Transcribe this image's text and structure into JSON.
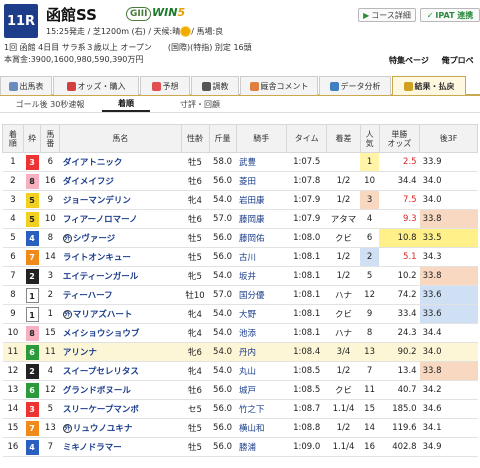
{
  "race": {
    "number": "11R",
    "name": "函館SS",
    "grade": "GIII",
    "win5_a": "WIN",
    "win5_b": "5",
    "line1a": "15:25発走 / 芝1200m (右) / 天候:晴",
    "line1b": "/ 馬場:良",
    "line2": "1回 函館 4日目 サラ系３歳以上 オープン　　(国際)(特指) 別定 16頭",
    "line3": "本賞金:3900,1600,980,590,390万円",
    "course_btn": "コース詳細",
    "ipat_btn": "IPAT 連携",
    "links": [
      "特集ページ",
      "俺プロペ"
    ]
  },
  "tabs": [
    {
      "label": "出馬表",
      "icon": "table-icon",
      "color": "#6a8cc0"
    },
    {
      "label": "オッズ・購入",
      "icon": "ticket-icon",
      "color": "#d04040"
    },
    {
      "label": "予想",
      "icon": "target-icon",
      "color": "#e05050"
    },
    {
      "label": "調教",
      "icon": "stopwatch-icon",
      "color": "#555"
    },
    {
      "label": "厩舎コメント",
      "icon": "comment-icon",
      "color": "#e08040"
    },
    {
      "label": "データ分析",
      "icon": "chart-icon",
      "color": "#4080c0"
    },
    {
      "label": "結果・払戻",
      "icon": "coins-icon",
      "color": "#d0a020"
    }
  ],
  "subtabs": [
    "ゴール後 30秒速報",
    "着順",
    "寸評・回顧"
  ],
  "columns": [
    "着\n順",
    "枠",
    "馬\n番",
    "馬名",
    "性齢",
    "斤量",
    "騎手",
    "タイム",
    "着差",
    "人\n気",
    "単勝\nオッズ",
    "後3F"
  ],
  "rows": [
    [
      "1",
      "3",
      "6",
      "ダイアトニック",
      "牡5",
      "58.0",
      "武豊",
      "1:07.5",
      "",
      "1",
      "2.5",
      "33.9",
      "",
      "",
      "l0",
      "p1",
      "pbad"
    ],
    [
      "2",
      "8",
      "16",
      "ダイメイフジ",
      "牡6",
      "56.0",
      "菱田",
      "1:07.8",
      "1/2",
      "10",
      "34.4",
      "34.0",
      "",
      "",
      "",
      "",
      ""
    ],
    [
      "3",
      "5",
      "9",
      "ジョーマンデリン",
      "牝4",
      "54.0",
      "岩田康",
      "1:07.9",
      "1/2",
      "3",
      "7.5",
      "34.0",
      "",
      "",
      "",
      "p3",
      "pbad"
    ],
    [
      "4",
      "5",
      "10",
      "フィアーノロマーノ",
      "牡6",
      "57.0",
      "藤岡康",
      "1:07.9",
      "アタマ",
      "4",
      "9.3",
      "33.8",
      "",
      "",
      "",
      "",
      "pbad"
    ],
    [
      "5",
      "4",
      "8",
      "シヴァージ",
      "牡5",
      "56.0",
      "藤岡佑",
      "1:08.0",
      "クビ",
      "6",
      "10.8",
      "33.5",
      "外",
      "",
      "",
      "",
      "l1"
    ],
    [
      "6",
      "7",
      "14",
      "ライトオンキュー",
      "牡5",
      "56.0",
      "古川",
      "1:08.1",
      "1/2",
      "2",
      "5.1",
      "34.3",
      "",
      "",
      "",
      "p2",
      "pbad"
    ],
    [
      "7",
      "2",
      "3",
      "エイティーンガール",
      "牝5",
      "54.0",
      "坂井",
      "1:08.1",
      "1/2",
      "5",
      "10.2",
      "33.8",
      "",
      "",
      "",
      "",
      ""
    ],
    [
      "8",
      "1",
      "2",
      "ティーハーフ",
      "牡10",
      "57.0",
      "国分優",
      "1:08.1",
      "ハナ",
      "12",
      "74.2",
      "33.6",
      "",
      "",
      "",
      "",
      ""
    ],
    [
      "9",
      "1",
      "1",
      "マリアズハート",
      "牝4",
      "54.0",
      "大野",
      "1:08.1",
      "クビ",
      "9",
      "33.4",
      "33.6",
      "外",
      "",
      "",
      "",
      ""
    ],
    [
      "10",
      "8",
      "15",
      "メイショウショウブ",
      "牝4",
      "54.0",
      "池添",
      "1:08.1",
      "ハナ",
      "8",
      "24.3",
      "34.4",
      "",
      "",
      "",
      "",
      ""
    ],
    [
      "11",
      "6",
      "11",
      "アリンナ",
      "牝6",
      "54.0",
      "丹内",
      "1:08.4",
      "3/4",
      "13",
      "90.2",
      "34.0",
      "",
      "hl",
      "",
      "",
      ""
    ],
    [
      "12",
      "2",
      "4",
      "スイープセレリタス",
      "牝4",
      "54.0",
      "丸山",
      "1:08.5",
      "1/2",
      "7",
      "13.4",
      "33.8",
      "",
      "",
      "",
      "",
      ""
    ],
    [
      "13",
      "6",
      "12",
      "グランドボヌール",
      "牡6",
      "56.0",
      "城戸",
      "1:08.5",
      "クビ",
      "11",
      "40.7",
      "34.2",
      "",
      "",
      "",
      "",
      ""
    ],
    [
      "14",
      "3",
      "5",
      "スリーケープマンボ",
      "セ5",
      "56.0",
      "竹之下",
      "1:08.7",
      "1.1/4",
      "15",
      "185.0",
      "34.6",
      "",
      "",
      "",
      "",
      ""
    ],
    [
      "15",
      "7",
      "13",
      "リュウノユキナ",
      "牡5",
      "56.0",
      "横山和",
      "1:08.8",
      "1/2",
      "14",
      "119.6",
      "34.1",
      "外",
      "",
      "",
      "",
      ""
    ],
    [
      "16",
      "4",
      "7",
      "ミキノドラマー",
      "牡5",
      "56.0",
      "勝浦",
      "1:09.0",
      "1.1/4",
      "16",
      "402.8",
      "34.9",
      "",
      "",
      "",
      "",
      ""
    ]
  ],
  "waku_colors": {
    "1": [
      "#fff",
      "#222"
    ],
    "2": [
      "#222",
      "#fff"
    ],
    "3": [
      "#e33",
      "#fff"
    ],
    "4": [
      "#2a5fc0",
      "#fff"
    ],
    "5": [
      "#f2d020",
      "#222"
    ],
    "6": [
      "#2a9a3a",
      "#fff"
    ],
    "7": [
      "#f08a1a",
      "#fff"
    ],
    "8": [
      "#f6b0c0",
      "#222"
    ]
  },
  "last3f_colors": {
    "33.5": "l1",
    "33.6": "l2",
    "33.8": "l3"
  }
}
